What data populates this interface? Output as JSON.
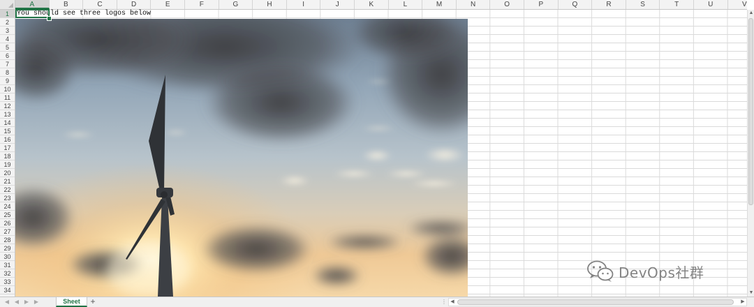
{
  "sheet": {
    "columns": [
      "A",
      "B",
      "C",
      "D",
      "E",
      "F",
      "G",
      "H",
      "I",
      "J",
      "K",
      "L",
      "M",
      "N",
      "O",
      "P",
      "Q",
      "R",
      "S",
      "T",
      "U",
      "V"
    ],
    "rows": [
      "1",
      "2",
      "3",
      "4",
      "5",
      "6",
      "7",
      "8",
      "9",
      "10",
      "11",
      "12",
      "13",
      "14",
      "15",
      "16",
      "17",
      "18",
      "19",
      "20",
      "21",
      "22",
      "23",
      "24",
      "25",
      "26",
      "27",
      "28",
      "29",
      "30",
      "31",
      "32",
      "33",
      "34"
    ],
    "active_cell": "A1",
    "cell_a1": "You should see three logos below"
  },
  "picture": {
    "description_icon": "wind-turbine-sunset-photo",
    "colors": {
      "sky_top": "#7f93a8",
      "sky_mid": "#b9c6cf",
      "horizon": "#f2c98e",
      "sun": "#fff3d0",
      "cloud": "#3e3d3f"
    }
  },
  "tabs": {
    "sheet_tab": "Sheet",
    "add_sheet": "+"
  },
  "watermark": {
    "text": "DevOps社群",
    "icon": "wechat-icon"
  },
  "colors": {
    "accent": "#217346",
    "grid": "#dadada",
    "header_bg": "#f3f3f3"
  }
}
